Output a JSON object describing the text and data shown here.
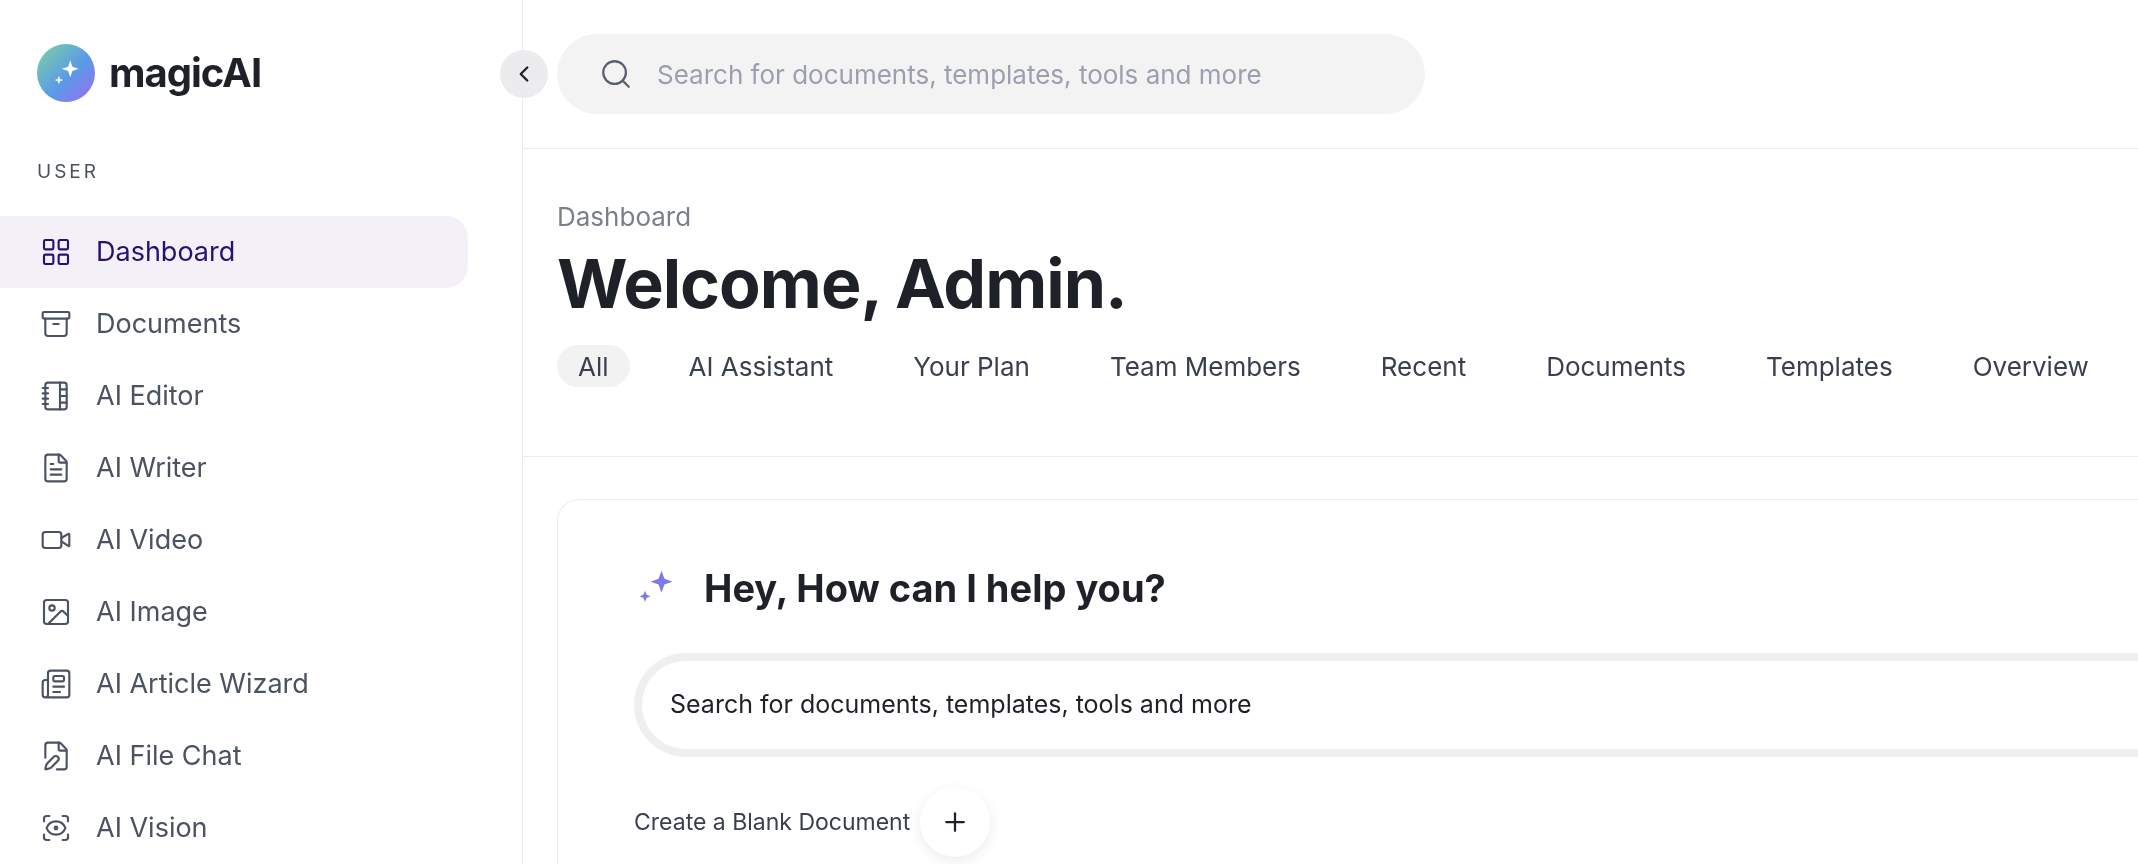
{
  "brand": {
    "name": "magicAI"
  },
  "sidebar": {
    "section_label": "USER",
    "items": [
      {
        "label": "Dashboard",
        "kind": "grid",
        "selected": true
      },
      {
        "label": "Documents",
        "kind": "archive",
        "selected": false
      },
      {
        "label": "AI Editor",
        "kind": "notebook",
        "selected": false
      },
      {
        "label": "AI Writer",
        "kind": "file-text",
        "selected": false
      },
      {
        "label": "AI Video",
        "kind": "video",
        "selected": false
      },
      {
        "label": "AI Image",
        "kind": "image",
        "selected": false
      },
      {
        "label": "AI Article Wizard",
        "kind": "article",
        "selected": false
      },
      {
        "label": "AI File Chat",
        "kind": "file-pen",
        "selected": false
      },
      {
        "label": "AI Vision",
        "kind": "scan-eye",
        "selected": false
      }
    ]
  },
  "top_search": {
    "placeholder": "Search for documents, templates, tools and more"
  },
  "breadcrumb": "Dashboard",
  "title": "Welcome, Admin.",
  "tabs": [
    {
      "label": "All",
      "selected": true
    },
    {
      "label": "AI Assistant",
      "selected": false
    },
    {
      "label": "Your Plan",
      "selected": false
    },
    {
      "label": "Team Members",
      "selected": false
    },
    {
      "label": "Recent",
      "selected": false
    },
    {
      "label": "Documents",
      "selected": false
    },
    {
      "label": "Templates",
      "selected": false
    },
    {
      "label": "Overview",
      "selected": false
    }
  ],
  "assistant": {
    "heading": "Hey, How can I help you?",
    "search_value": "Search for documents, templates, tools and more",
    "create_label": "Create a Blank Document"
  }
}
